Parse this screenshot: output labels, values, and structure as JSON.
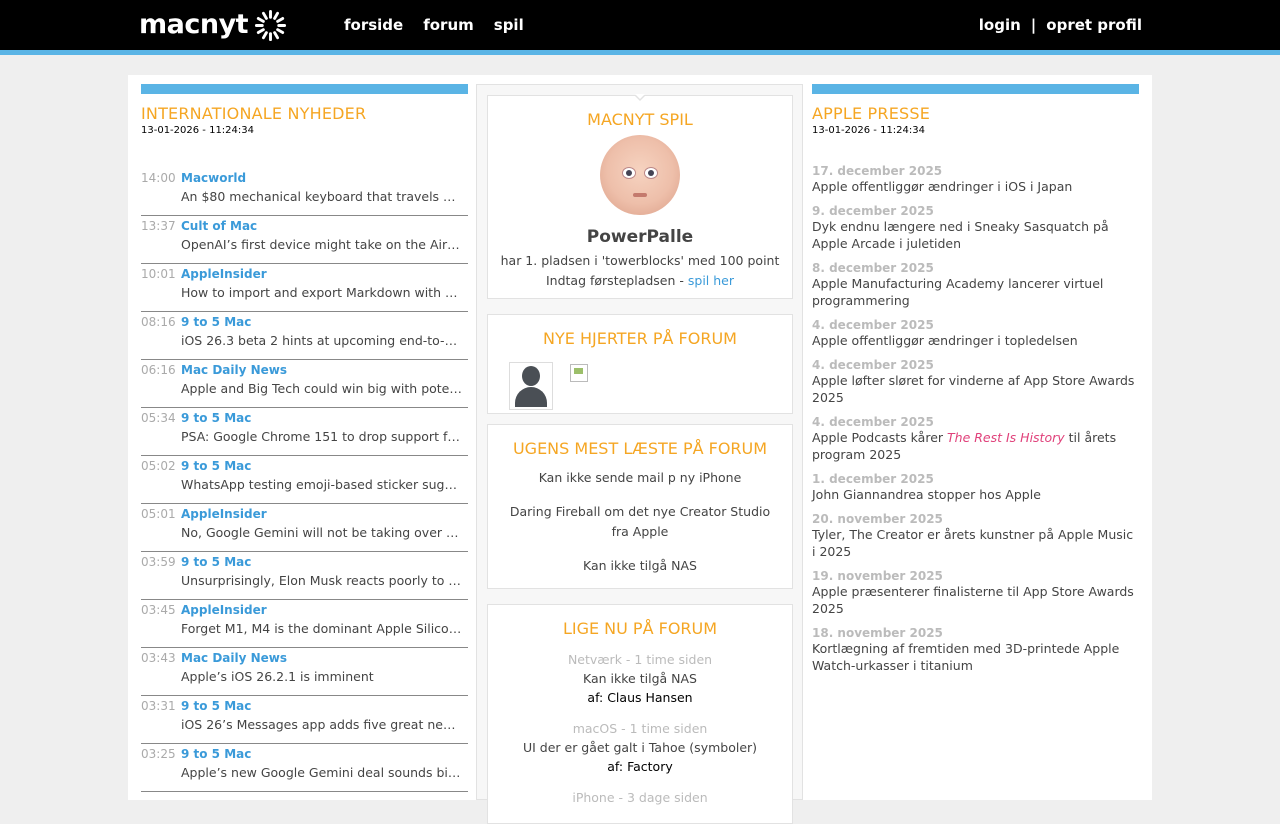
{
  "header": {
    "logo_text": "macnyt",
    "nav": [
      "forside",
      "forum",
      "spil"
    ],
    "login": "login",
    "separator": "|",
    "signup": "opret profil"
  },
  "left": {
    "title": "INTERNATIONALE NYHEDER",
    "date": "13-01-2026 - 11:24:34",
    "items": [
      {
        "time": "14:00",
        "source": "Macworld",
        "headline": "An $80 mechanical keyboard that travels well…"
      },
      {
        "time": "13:37",
        "source": "Cult of Mac",
        "headline": "OpenAI’s first device might take on the AirPods"
      },
      {
        "time": "10:01",
        "source": "AppleInsider",
        "headline": "How to import and export Markdown with A…"
      },
      {
        "time": "08:16",
        "source": "9 to 5 Mac",
        "headline": "iOS 26.3 beta 2 hints at upcoming end-to-end …"
      },
      {
        "time": "06:16",
        "source": "Mac Daily News",
        "headline": "Apple and Big Tech could win big with potenti…"
      },
      {
        "time": "05:34",
        "source": "9 to 5 Mac",
        "headline": "PSA: Google Chrome 151 to drop support for …"
      },
      {
        "time": "05:02",
        "source": "9 to 5 Mac",
        "headline": "WhatsApp testing emoji-based sticker sugges…"
      },
      {
        "time": "05:01",
        "source": "AppleInsider",
        "headline": "No, Google Gemini will not be taking over you…"
      },
      {
        "time": "03:59",
        "source": "9 to 5 Mac",
        "headline": "Unsurprisingly, Elon Musk reacts poorly to Ap…"
      },
      {
        "time": "03:45",
        "source": "AppleInsider",
        "headline": "Forget M1, M4 is the dominant Apple Silicon c…"
      },
      {
        "time": "03:43",
        "source": "Mac Daily News",
        "headline": "Apple’s iOS 26.2.1 is imminent"
      },
      {
        "time": "03:31",
        "source": "9 to 5 Mac",
        "headline": "iOS 26’s Messages app adds five great new gr…"
      },
      {
        "time": "03:25",
        "source": "9 to 5 Mac",
        "headline": "Apple’s new Google Gemini deal sounds bigge…"
      }
    ]
  },
  "mid": {
    "game": {
      "title": "MACNYT SPIL",
      "player": "PowerPalle",
      "line1": "har 1. pladsen i 'towerblocks' med 100 point",
      "line2_prefix": "Indtag førstepladsen - ",
      "line2_link": "spil her"
    },
    "hearts": {
      "title": "NYE HJERTER PÅ FORUM"
    },
    "mostread": {
      "title": "UGENS MEST LÆSTE PÅ FORUM",
      "items": [
        "Kan ikke sende mail p ny iPhone",
        "Daring Fireball om det nye Creator Studio fra Apple",
        "Kan ikke tilgå NAS"
      ]
    },
    "now": {
      "title": "LIGE NU PÅ FORUM",
      "items": [
        {
          "category": "Netværk - 1 time siden",
          "title": "Kan ikke tilgå NAS",
          "author": "af: Claus Hansen"
        },
        {
          "category": "macOS - 1 time siden",
          "title": "UI der er gået galt i Tahoe (symboler)",
          "author": "af: Factory"
        },
        {
          "category": "iPhone - 3 dage siden",
          "title": "",
          "author": ""
        }
      ]
    }
  },
  "right": {
    "title": "APPLE PRESSE",
    "date": "13-01-2026 - 11:24:34",
    "items": [
      {
        "date": "17. december 2025",
        "title": "Apple offentliggør ændringer i iOS i Japan"
      },
      {
        "date": "9. december 2025",
        "title": "Dyk endnu længere ned i Sneaky Sasquatch på Apple Arcade i juletiden"
      },
      {
        "date": "8. december 2025",
        "title": "Apple Manufacturing Academy lancerer virtuel programmering"
      },
      {
        "date": "4. december 2025",
        "title": "Apple offentliggør ændringer i topledelsen"
      },
      {
        "date": "4. december 2025",
        "title": "Apple løfter sløret for vinderne af App Store Awards 2025"
      },
      {
        "date": "4. december 2025",
        "title_prefix": "Apple Podcasts kårer ",
        "title_em": "The Rest Is History",
        "title_suffix": " til årets program 2025"
      },
      {
        "date": "1. december 2025",
        "title": "John Giannandrea stopper hos Apple"
      },
      {
        "date": "20. november 2025",
        "title": "Tyler, The Creator er årets kunstner på Apple Music i 2025"
      },
      {
        "date": "19. november 2025",
        "title": "Apple præsenterer finalisterne til App Store Awards 2025"
      },
      {
        "date": "18. november 2025",
        "title": "Kortlægning af fremtiden med 3D-printede Apple Watch-urkasser i titanium"
      }
    ]
  }
}
